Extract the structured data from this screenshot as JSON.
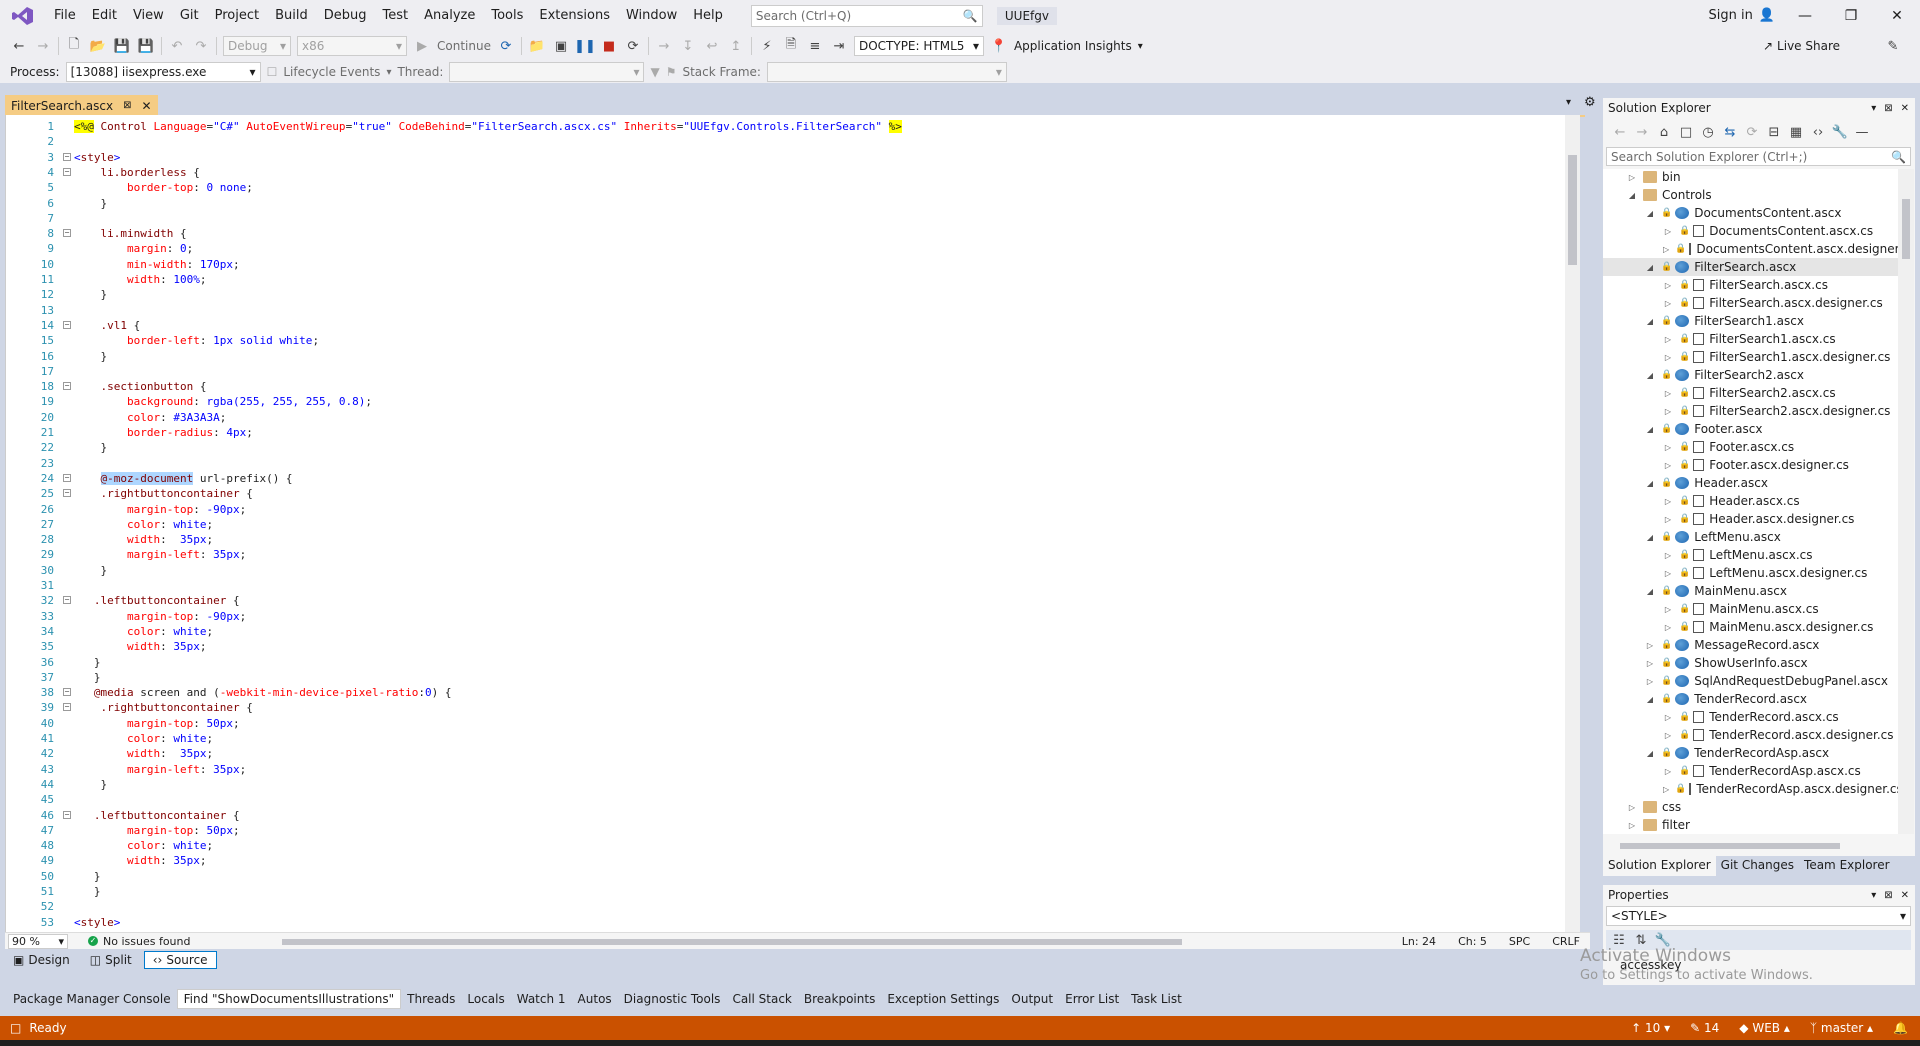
{
  "menu": {
    "items": [
      "File",
      "Edit",
      "View",
      "Git",
      "Project",
      "Build",
      "Debug",
      "Test",
      "Analyze",
      "Tools",
      "Extensions",
      "Window",
      "Help"
    ],
    "search_placeholder": "Search (Ctrl+Q)",
    "solution_name": "UUEfgv",
    "sign_in": "Sign in"
  },
  "toolbar": {
    "config": "Debug",
    "platform": "x86",
    "continue": "Continue",
    "doctype": "DOCTYPE: HTML5",
    "app_insights": "Application Insights",
    "live_share": "Live Share",
    "process_label": "Process:",
    "process_value": "[13088] iisexpress.exe",
    "lifecycle": "Lifecycle Events",
    "thread_label": "Thread:",
    "stack_label": "Stack Frame:"
  },
  "doc_tab": {
    "title": "FilterSearch.ascx"
  },
  "editor": {
    "lines": [
      {
        "n": "1",
        "code": "<%@ Control Language=\"C#\" AutoEventWireup=\"true\" CodeBehind=\"FilterSearch.ascx.cs\" Inherits=\"UUEfgv.Controls.FilterSearch\" %>"
      },
      {
        "n": "2",
        "code": ""
      },
      {
        "n": "3",
        "code": "<style>"
      },
      {
        "n": "4",
        "code": "    li.borderless {"
      },
      {
        "n": "5",
        "code": "        border-top: 0 none;"
      },
      {
        "n": "6",
        "code": "    }"
      },
      {
        "n": "7",
        "code": ""
      },
      {
        "n": "8",
        "code": "    li.minwidth {"
      },
      {
        "n": "9",
        "code": "        margin: 0;"
      },
      {
        "n": "10",
        "code": "        min-width: 170px;"
      },
      {
        "n": "11",
        "code": "        width: 100%;"
      },
      {
        "n": "12",
        "code": "    }"
      },
      {
        "n": "13",
        "code": ""
      },
      {
        "n": "14",
        "code": "    .vl1 {"
      },
      {
        "n": "15",
        "code": "        border-left: 1px solid white;"
      },
      {
        "n": "16",
        "code": "    }"
      },
      {
        "n": "17",
        "code": ""
      },
      {
        "n": "18",
        "code": "    .sectionbutton {"
      },
      {
        "n": "19",
        "code": "        background: rgba(255, 255, 255, 0.8);"
      },
      {
        "n": "20",
        "code": "        color: #3A3A3A;"
      },
      {
        "n": "21",
        "code": "        border-radius: 4px;"
      },
      {
        "n": "22",
        "code": "    }"
      },
      {
        "n": "23",
        "code": ""
      },
      {
        "n": "24",
        "code": "    @-moz-document url-prefix() {"
      },
      {
        "n": "25",
        "code": "    .rightbuttoncontainer {"
      },
      {
        "n": "26",
        "code": "        margin-top: -90px;"
      },
      {
        "n": "27",
        "code": "        color: white;"
      },
      {
        "n": "28",
        "code": "        width:  35px;"
      },
      {
        "n": "29",
        "code": "        margin-left: 35px;"
      },
      {
        "n": "30",
        "code": "    }"
      },
      {
        "n": "31",
        "code": ""
      },
      {
        "n": "32",
        "code": "   .leftbuttoncontainer {"
      },
      {
        "n": "33",
        "code": "        margin-top: -90px;"
      },
      {
        "n": "34",
        "code": "        color: white;"
      },
      {
        "n": "35",
        "code": "        width: 35px;"
      },
      {
        "n": "36",
        "code": "   }"
      },
      {
        "n": "37",
        "code": "   }"
      },
      {
        "n": "38",
        "code": "   @media screen and (-webkit-min-device-pixel-ratio:0) {"
      },
      {
        "n": "39",
        "code": "    .rightbuttoncontainer {"
      },
      {
        "n": "40",
        "code": "        margin-top: 50px;"
      },
      {
        "n": "41",
        "code": "        color: white;"
      },
      {
        "n": "42",
        "code": "        width:  35px;"
      },
      {
        "n": "43",
        "code": "        margin-left: 35px;"
      },
      {
        "n": "44",
        "code": "    }"
      },
      {
        "n": "45",
        "code": ""
      },
      {
        "n": "46",
        "code": "   .leftbuttoncontainer {"
      },
      {
        "n": "47",
        "code": "        margin-top: 50px;"
      },
      {
        "n": "48",
        "code": "        color: white;"
      },
      {
        "n": "49",
        "code": "        width: 35px;"
      },
      {
        "n": "50",
        "code": "   }"
      },
      {
        "n": "51",
        "code": "   }"
      },
      {
        "n": "52",
        "code": ""
      },
      {
        "n": "53",
        "code": "</style>"
      }
    ],
    "zoom": "90 %",
    "issues": "No issues found",
    "ln": "Ln: 24",
    "ch": "Ch: 5",
    "spc": "SPC",
    "crlf": "CRLF"
  },
  "view_tabs": [
    "Design",
    "Split",
    "Source"
  ],
  "solution_explorer": {
    "title": "Solution Explorer",
    "search_placeholder": "Search Solution Explorer (Ctrl+;)",
    "tree": [
      {
        "label": "bin",
        "level": 0,
        "type": "folder",
        "exp": "collapsed"
      },
      {
        "label": "Controls",
        "level": 0,
        "type": "folder",
        "exp": "expanded"
      },
      {
        "label": "DocumentsContent.ascx",
        "level": 1,
        "type": "ascx",
        "exp": "expanded"
      },
      {
        "label": "DocumentsContent.ascx.cs",
        "level": 2,
        "type": "file",
        "exp": "collapsed"
      },
      {
        "label": "DocumentsContent.ascx.designer.c",
        "level": 2,
        "type": "file",
        "exp": "collapsed"
      },
      {
        "label": "FilterSearch.ascx",
        "level": 1,
        "type": "ascx",
        "exp": "expanded",
        "selected": true
      },
      {
        "label": "FilterSearch.ascx.cs",
        "level": 2,
        "type": "file",
        "exp": "collapsed"
      },
      {
        "label": "FilterSearch.ascx.designer.cs",
        "level": 2,
        "type": "file",
        "exp": "collapsed"
      },
      {
        "label": "FilterSearch1.ascx",
        "level": 1,
        "type": "ascx",
        "exp": "expanded"
      },
      {
        "label": "FilterSearch1.ascx.cs",
        "level": 2,
        "type": "file",
        "exp": "collapsed"
      },
      {
        "label": "FilterSearch1.ascx.designer.cs",
        "level": 2,
        "type": "file",
        "exp": "collapsed"
      },
      {
        "label": "FilterSearch2.ascx",
        "level": 1,
        "type": "ascx",
        "exp": "expanded"
      },
      {
        "label": "FilterSearch2.ascx.cs",
        "level": 2,
        "type": "file",
        "exp": "collapsed"
      },
      {
        "label": "FilterSearch2.ascx.designer.cs",
        "level": 2,
        "type": "file",
        "exp": "collapsed"
      },
      {
        "label": "Footer.ascx",
        "level": 1,
        "type": "ascx",
        "exp": "expanded"
      },
      {
        "label": "Footer.ascx.cs",
        "level": 2,
        "type": "file",
        "exp": "collapsed"
      },
      {
        "label": "Footer.ascx.designer.cs",
        "level": 2,
        "type": "file",
        "exp": "collapsed"
      },
      {
        "label": "Header.ascx",
        "level": 1,
        "type": "ascx",
        "exp": "expanded"
      },
      {
        "label": "Header.ascx.cs",
        "level": 2,
        "type": "file",
        "exp": "collapsed"
      },
      {
        "label": "Header.ascx.designer.cs",
        "level": 2,
        "type": "file",
        "exp": "collapsed"
      },
      {
        "label": "LeftMenu.ascx",
        "level": 1,
        "type": "ascx",
        "exp": "expanded"
      },
      {
        "label": "LeftMenu.ascx.cs",
        "level": 2,
        "type": "file",
        "exp": "collapsed"
      },
      {
        "label": "LeftMenu.ascx.designer.cs",
        "level": 2,
        "type": "file",
        "exp": "collapsed"
      },
      {
        "label": "MainMenu.ascx",
        "level": 1,
        "type": "ascx",
        "exp": "expanded"
      },
      {
        "label": "MainMenu.ascx.cs",
        "level": 2,
        "type": "file",
        "exp": "collapsed"
      },
      {
        "label": "MainMenu.ascx.designer.cs",
        "level": 2,
        "type": "file",
        "exp": "collapsed"
      },
      {
        "label": "MessageRecord.ascx",
        "level": 1,
        "type": "ascx",
        "exp": "collapsed"
      },
      {
        "label": "ShowUserInfo.ascx",
        "level": 1,
        "type": "ascx",
        "exp": "collapsed"
      },
      {
        "label": "SqlAndRequestDebugPanel.ascx",
        "level": 1,
        "type": "ascx",
        "exp": "collapsed"
      },
      {
        "label": "TenderRecord.ascx",
        "level": 1,
        "type": "ascx",
        "exp": "expanded"
      },
      {
        "label": "TenderRecord.ascx.cs",
        "level": 2,
        "type": "file",
        "exp": "collapsed"
      },
      {
        "label": "TenderRecord.ascx.designer.cs",
        "level": 2,
        "type": "file",
        "exp": "collapsed"
      },
      {
        "label": "TenderRecordAsp.ascx",
        "level": 1,
        "type": "ascx",
        "exp": "expanded"
      },
      {
        "label": "TenderRecordAsp.ascx.cs",
        "level": 2,
        "type": "file",
        "exp": "collapsed"
      },
      {
        "label": "TenderRecordAsp.ascx.designer.cs",
        "level": 2,
        "type": "file",
        "exp": "collapsed"
      },
      {
        "label": "css",
        "level": 0,
        "type": "folder",
        "exp": "collapsed"
      },
      {
        "label": "filter",
        "level": 0,
        "type": "folder",
        "exp": "collapsed"
      }
    ],
    "tabs": [
      "Solution Explorer",
      "Git Changes",
      "Team Explorer"
    ]
  },
  "properties": {
    "title": "Properties",
    "object": "<STYLE>",
    "row": "accesskey",
    "watermark_title": "Activate Windows",
    "watermark_sub": "Go to Settings to activate Windows."
  },
  "bottom_tabs": [
    "Package Manager Console",
    "Find \"ShowDocumentsIllustrations\"",
    "Threads",
    "Locals",
    "Watch 1",
    "Autos",
    "Diagnostic Tools",
    "Call Stack",
    "Breakpoints",
    "Exception Settings",
    "Output",
    "Error List",
    "Task List"
  ],
  "status": {
    "ready": "Ready",
    "up_count": "10",
    "edit_count": "14",
    "web": "WEB",
    "branch": "master"
  },
  "colors": {
    "accent": "#ca5100",
    "tab_active": "#f5cc84"
  }
}
